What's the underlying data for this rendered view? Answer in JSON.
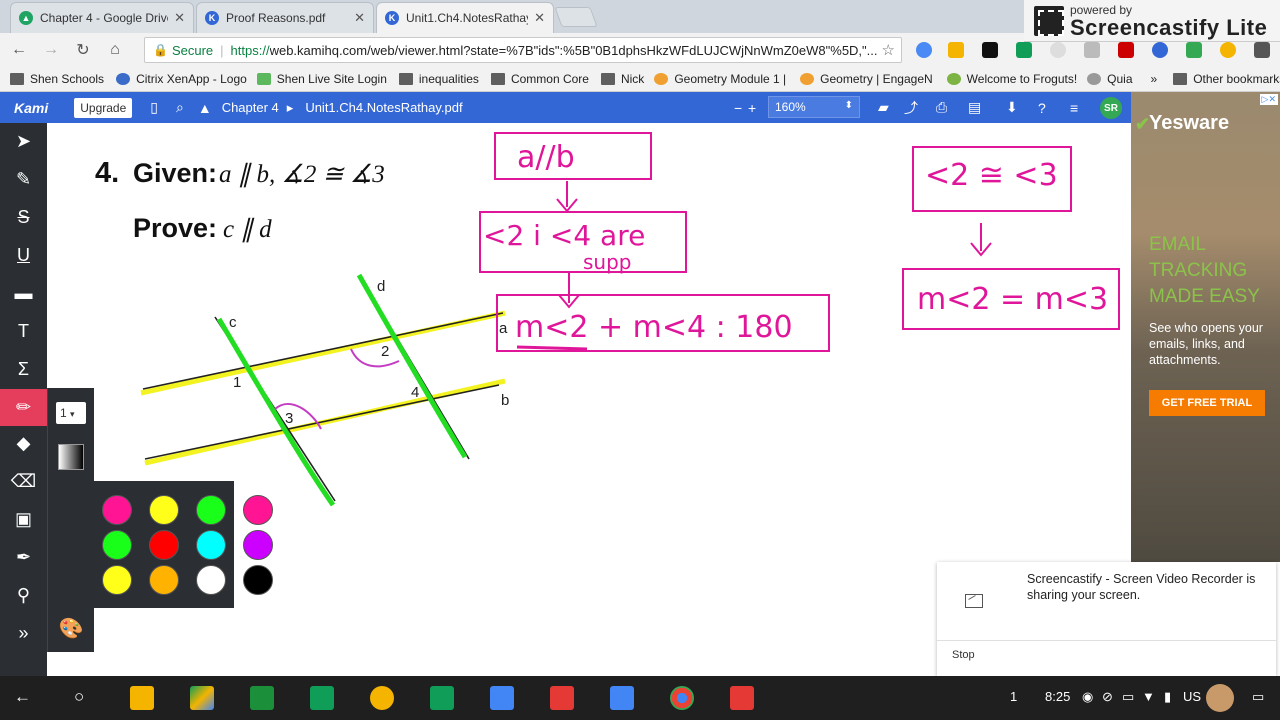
{
  "browser": {
    "tabs": [
      {
        "label": "Chapter 4 - Google Drive",
        "icon": "google-drive-icon",
        "color": "#1fa463"
      },
      {
        "label": "Proof Reasons.pdf",
        "icon": "kami-icon",
        "color": "#3367d6"
      },
      {
        "label": "Unit1.Ch4.NotesRathay",
        "icon": "kami-icon",
        "color": "#3367d6"
      }
    ],
    "badge_top": "powered by",
    "badge_brand": "Screencastify Lite",
    "secure_label": "Secure",
    "url_proto": "https://",
    "url": "web.kamihq.com/web/viewer.html?state=%7B\"ids\":%5B\"0B1dphsHkzWFdLUJCWjNnWmZ0eW8\"%5D,\"..."
  },
  "bookmarks": [
    {
      "label": "Shen Schools",
      "icon": "folder-icon"
    },
    {
      "label": "Citrix XenApp - Logo",
      "icon": "citrix-icon"
    },
    {
      "label": "Shen Live Site Login",
      "icon": "site-icon"
    },
    {
      "label": "inequalities",
      "icon": "folder-icon"
    },
    {
      "label": "Common Core",
      "icon": "folder-icon"
    },
    {
      "label": "Nick",
      "icon": "folder-icon"
    },
    {
      "label": "Geometry Module 1 |",
      "icon": "engage-icon"
    },
    {
      "label": "Geometry | EngageN",
      "icon": "engage-icon"
    },
    {
      "label": "Welcome to Froguts!",
      "icon": "frog-icon"
    },
    {
      "label": "Quia",
      "icon": "quia-icon"
    }
  ],
  "bookmarks_more": "»",
  "other_bookmarks": "Other bookmarks",
  "kami": {
    "logo": "Kami",
    "upgrade": "Upgrade",
    "crumb_folder": "Chapter 4",
    "crumb_sep": "▸",
    "crumb_file": "Unit1.Ch4.NotesRathay.pdf",
    "zoom": "160%",
    "avatar": "SR"
  },
  "tools": [
    {
      "name": "select-tool",
      "glyph": "➤"
    },
    {
      "name": "highlight-tool",
      "glyph": "✎"
    },
    {
      "name": "strikethrough-tool",
      "glyph": "S"
    },
    {
      "name": "underline-tool",
      "glyph": "U"
    },
    {
      "name": "comment-tool",
      "glyph": "▬"
    },
    {
      "name": "text-tool",
      "glyph": "T"
    },
    {
      "name": "equation-tool",
      "glyph": "Σ"
    },
    {
      "name": "draw-tool",
      "glyph": "✏"
    },
    {
      "name": "shapes-tool",
      "glyph": "◆"
    },
    {
      "name": "eraser-tool",
      "glyph": "⌫"
    },
    {
      "name": "image-tool",
      "glyph": "▣"
    },
    {
      "name": "signature-tool",
      "glyph": "✒"
    },
    {
      "name": "stamp-tool",
      "glyph": "⚲"
    },
    {
      "name": "expand-tool",
      "glyph": "»"
    }
  ],
  "draw_size": "1",
  "swatches": [
    "#ff1493",
    "#ffff1a",
    "#1aff1a",
    "#ff1493",
    "#1aff1a",
    "#ff0000",
    "#00ffff",
    "#cc00ff",
    "#ffff1a",
    "#ffb300",
    "#ffffff",
    "#000000"
  ],
  "document": {
    "problem_number": "4.",
    "given_label": "Given:",
    "given_math": "a ∥ b, ∡2 ≅ ∡3",
    "prove_label": "Prove:",
    "prove_math": "c ∥ d",
    "line_labels": {
      "a": "a",
      "b": "b",
      "c": "c",
      "d": "d"
    },
    "angle_labels": [
      "1",
      "2",
      "3",
      "4"
    ],
    "flow_left": [
      "a//b",
      "<2 i <4 are",
      "supp",
      "m<2 + m<4 : 180"
    ],
    "flow_right": [
      "<2 ≅ <3",
      "m<2 = m<3"
    ],
    "ink_colors": {
      "pink": "#e0169a",
      "green": "#22dd22",
      "yellow": "#f2f20a"
    }
  },
  "ad": {
    "brand": "Yesware",
    "headline": "EMAIL TRACKING MADE EASY",
    "subtext": "See who opens your emails, links, and attachments.",
    "cta": "GET FREE TRIAL",
    "choice": "▷✕"
  },
  "notification": {
    "message": "Screencastify - Screen Video Recorder is sharing your screen.",
    "stop": "Stop"
  },
  "shelf": {
    "workspace": "1",
    "time": "8:25",
    "locale": "US"
  }
}
